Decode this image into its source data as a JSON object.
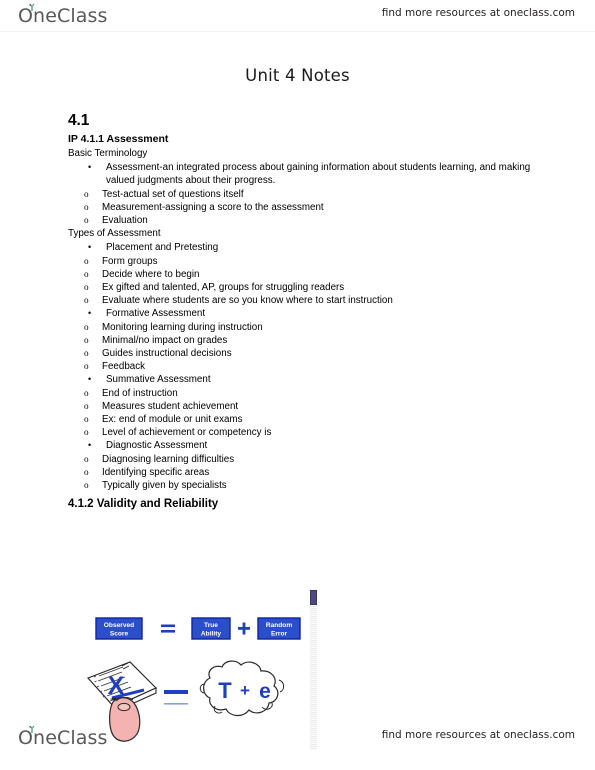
{
  "branding": {
    "logo_text": "OneClass",
    "logo_icon": "sprout-leaf-icon",
    "resources_note": "find more resources at oneclass.com"
  },
  "document": {
    "title": "Unit 4 Notes",
    "heading_number": "4.1",
    "heading_sub": "IP 4.1.1 Assessment",
    "terminology_label": "Basic Terminology",
    "types_label": "Types of Assessment",
    "section_heading": "4.1.2 Validity and Reliability",
    "bullet_glyph": "•",
    "subbullet_glyph": "o",
    "terminology": [
      {
        "text": "Assessment-an integrated process about gaining information about students learning, and making valued judgments about their progress.",
        "sub": [
          "Test-actual set of questions itself",
          "Measurement-assigning a score to the assessment",
          "Evaluation"
        ]
      }
    ],
    "types": [
      {
        "text": "Placement and Pretesting",
        "sub": [
          "Form groups",
          "Decide where to begin",
          "Ex gifted and talented, AP, groups for struggling readers",
          "Evaluate where students are so you know where to start instruction"
        ]
      },
      {
        "text": "Formative Assessment",
        "sub": [
          "Monitoring learning during instruction",
          "Minimal/no impact on grades",
          "Guides instructional decisions",
          "Feedback"
        ]
      },
      {
        "text": "Summative Assessment",
        "sub": [
          "End of instruction",
          "Measures student achievement",
          "Ex: end of module or unit exams",
          "Level of achievement or competency is"
        ]
      },
      {
        "text": "Diagnostic Assessment",
        "sub": [
          "Diagnosing learning difficulties",
          "Identifying specific areas",
          "Typically given by specialists"
        ]
      }
    ]
  },
  "figure": {
    "name": "classical-test-theory-diagram",
    "box_observed_line1": "Observed",
    "box_observed_line2": "Score",
    "equals_sign": "=",
    "box_true_line1": "True",
    "box_true_line2": "Ability",
    "plus_sign": "+",
    "box_error_line1": "Random",
    "box_error_line2": "Error",
    "symbol_observed": "X",
    "symbol_equals": "=",
    "symbol_true": "T",
    "symbol_plus": "+",
    "symbol_error": "e",
    "colors": {
      "box_fill": "#2b4fcb",
      "box_border": "#10239e",
      "box_text": "#ffffff",
      "symbol_blue": "#1f3fbf",
      "hand_fill": "#f4b3b0",
      "outline": "#1a1a1a",
      "scrollbar_thumb": "#4e4a7a"
    }
  }
}
